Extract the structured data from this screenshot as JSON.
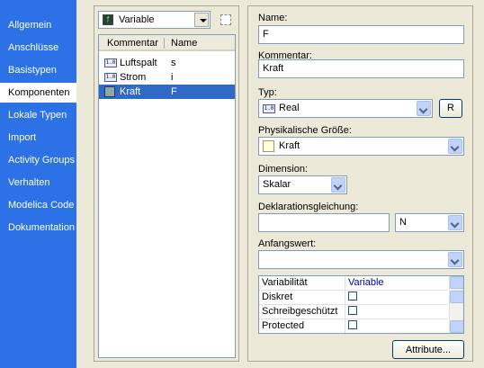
{
  "nav": {
    "items": [
      {
        "label": "Allgemein"
      },
      {
        "label": "Anschlüsse"
      },
      {
        "label": "Basistypen"
      },
      {
        "label": "Komponenten"
      },
      {
        "label": "Lokale Typen"
      },
      {
        "label": "Import"
      },
      {
        "label": "Activity Groups"
      },
      {
        "label": "Verhalten"
      },
      {
        "label": "Modelica Code"
      },
      {
        "label": "Dokumentation"
      }
    ],
    "selected": "Komponenten"
  },
  "filter": {
    "value": "Variable",
    "icon": "variable-icon"
  },
  "list": {
    "columns": [
      "Kommentar",
      "Name"
    ],
    "rows": [
      {
        "comment": "Luftspalt",
        "name": "s",
        "icon": "real-type-icon"
      },
      {
        "comment": "Strom",
        "name": "i",
        "icon": "real-type-icon"
      },
      {
        "comment": "Kraft",
        "name": "F",
        "icon": "force-type-icon",
        "selected": true
      }
    ]
  },
  "form": {
    "name_label": "Name:",
    "name_value": "F",
    "comment_label": "Kommentar:",
    "comment_value": "Kraft",
    "type_label": "Typ:",
    "type_value": "Real",
    "type_button": "R",
    "physical_label": "Physikalische Größe:",
    "physical_value": "Kraft",
    "dimension_label": "Dimension:",
    "dimension_value": "Skalar",
    "equation_label": "Deklarationsgleichung:",
    "equation_value": "",
    "unit_value": "N",
    "initial_label": "Anfangswert:",
    "initial_value": "",
    "attributes_button": "Attribute..."
  },
  "props": {
    "rows": [
      {
        "label": "Variabilität",
        "value": "Variable"
      },
      {
        "label": "Diskret",
        "checked": false
      },
      {
        "label": "Schreibgeschützt",
        "checked": false
      },
      {
        "label": "Protected",
        "checked": false
      }
    ]
  }
}
